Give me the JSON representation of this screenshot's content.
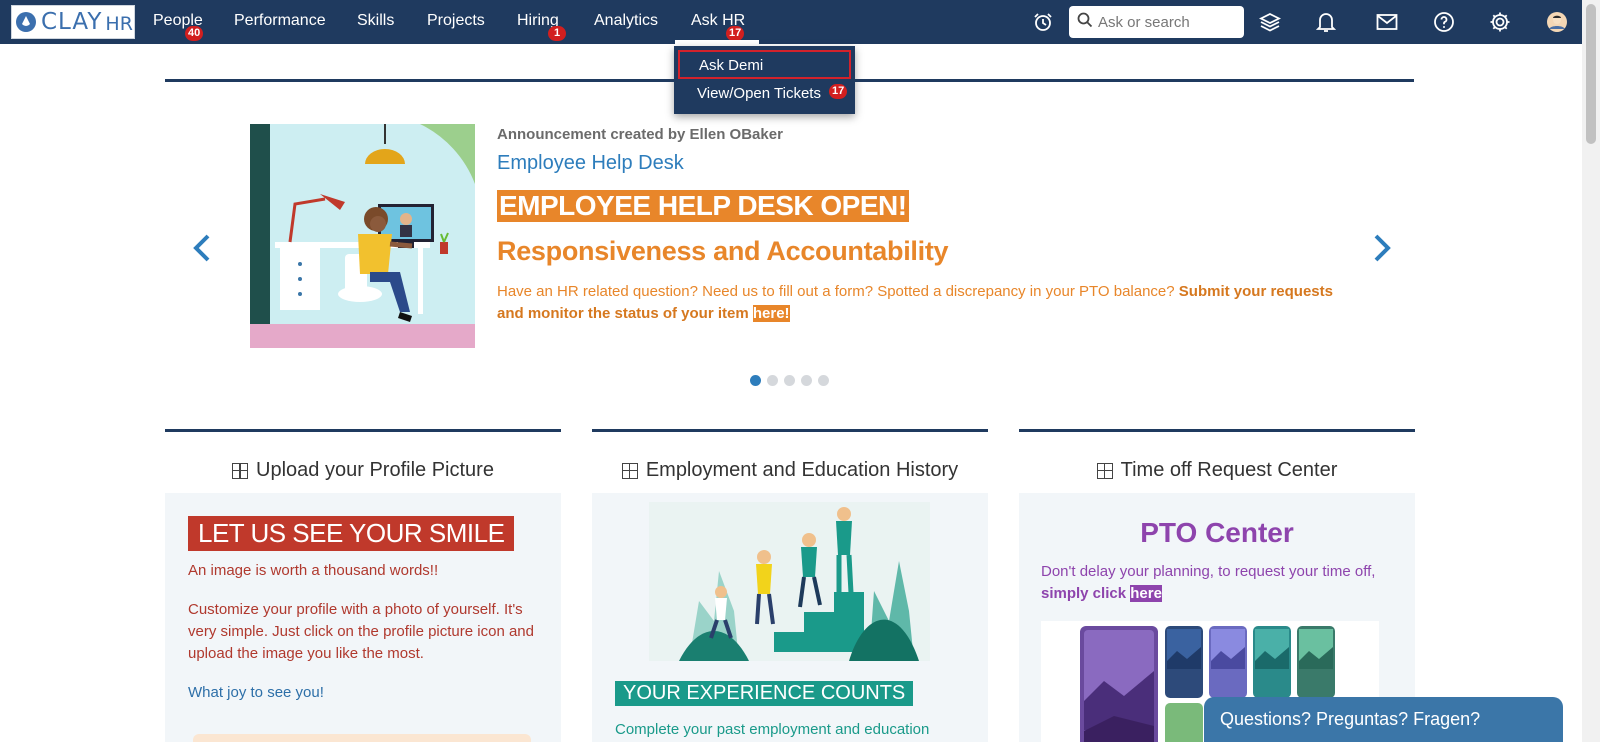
{
  "brand": {
    "name": "CLAY",
    "suffix": "HR"
  },
  "nav": {
    "items": [
      {
        "label": "People",
        "badge": "40"
      },
      {
        "label": "Performance",
        "badge": ""
      },
      {
        "label": "Skills",
        "badge": ""
      },
      {
        "label": "Projects",
        "badge": ""
      },
      {
        "label": "Hiring",
        "badge": "1"
      },
      {
        "label": "Analytics",
        "badge": ""
      },
      {
        "label": "Ask HR",
        "badge": "17"
      }
    ],
    "active": "Ask HR"
  },
  "search": {
    "placeholder": "Ask or search"
  },
  "top_icons": [
    "alarm-clock-icon",
    "layers-icon",
    "bell-icon",
    "mail-icon",
    "help-icon",
    "gear-icon",
    "avatar"
  ],
  "dropdown": {
    "items": [
      {
        "label": "Ask Demi",
        "badge": ""
      },
      {
        "label": "View/Open Tickets",
        "badge": "17"
      }
    ]
  },
  "announcement": {
    "meta": "Announcement created by Ellen OBaker",
    "link": "Employee Help Desk",
    "headline": "EMPLOYEE HELP DESK OPEN!",
    "subheadline": "Responsiveness and Accountability",
    "body_plain": "Have an HR related question? Need us to fill out a form? Spotted a discrepancy in your PTO balance? ",
    "body_bold": "Submit your requests and monitor the status of your item",
    "body_here": "here!",
    "slide_count": 5,
    "active_slide": 1
  },
  "cards": [
    {
      "title": "Upload your Profile Picture",
      "headline": "LET US SEE YOUR SMILE",
      "line1": "An image is worth a thousand words!!",
      "line2": "Customize your profile with a photo of yourself. It's very simple. Just click on the profile picture icon and upload the image you like the most.",
      "line3": "What joy to see you!"
    },
    {
      "title": "Employment and Education History",
      "headline": "YOUR EXPERIENCE COUNTS",
      "line1": "Complete your past employment and education"
    },
    {
      "title": "Time off Request Center",
      "headline": "PTO Center",
      "line1": "Don't delay your planning, to request your time off,",
      "line2_bold": "simply click",
      "line2_here": "here"
    }
  ],
  "chat": {
    "label": "Questions? Preguntas? Fragen?"
  },
  "colors": {
    "nav_bg": "#1f3a5f",
    "accent_orange": "#e8862a",
    "accent_red": "#c0392b",
    "accent_teal": "#1a9a8a",
    "accent_purple": "#8e44ad",
    "link_blue": "#2d7dbc"
  }
}
